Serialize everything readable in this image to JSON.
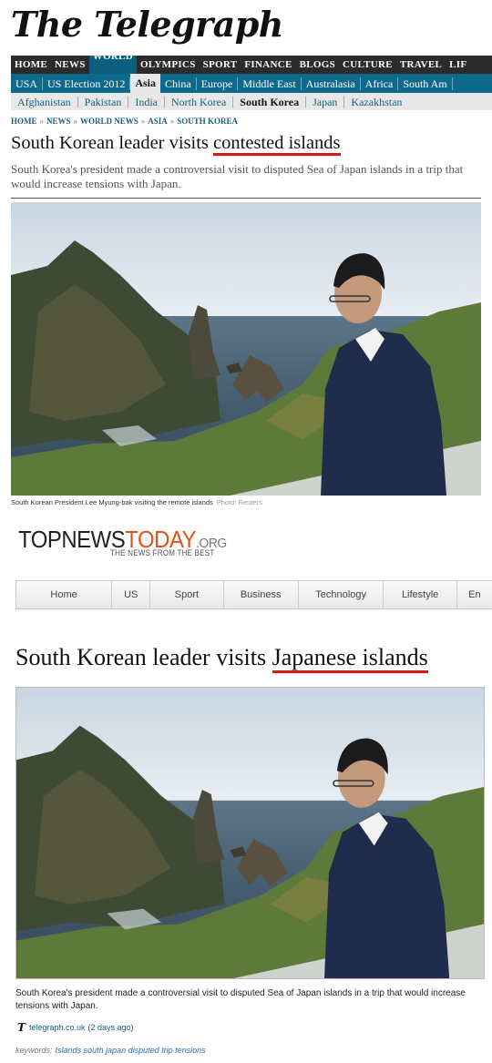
{
  "telegraph": {
    "logo": "The Telegraph",
    "nav_primary": [
      "HOME",
      "NEWS",
      "WORLD",
      "OLYMPICS",
      "SPORT",
      "FINANCE",
      "BLOGS",
      "CULTURE",
      "TRAVEL",
      "LIF"
    ],
    "nav_primary_active": "WORLD",
    "nav_secondary": [
      "USA",
      "US Election 2012",
      "Asia",
      "China",
      "Europe",
      "Middle East",
      "Australasia",
      "Africa",
      "South Am"
    ],
    "nav_secondary_active": "Asia",
    "nav_tertiary": [
      "Afghanistan",
      "Pakistan",
      "India",
      "North Korea",
      "South Korea",
      "Japan",
      "Kazakhstan"
    ],
    "nav_tertiary_active": "South Korea",
    "breadcrumb": [
      "HOME",
      "NEWS",
      "WORLD NEWS",
      "ASIA",
      "SOUTH KOREA"
    ],
    "breadcrumb_sep": "»",
    "headline_pre": "South Korean leader visits ",
    "headline_highlight": "contested islands",
    "standfirst": "South Korea's president made a controversial visit to disputed Sea of Japan islands in a trip that would increase tensions with Japan.",
    "caption": "South Korean President Lee Myung-bak visiting the remote islands",
    "photo_credit": "Photo: Reuters"
  },
  "topnewstoday": {
    "logo_part1": "TOPNEWS",
    "logo_part2": "TODAY",
    "logo_part3": ".ORG",
    "tagline": "THE NEWS FROM THE BEST",
    "nav": [
      "Home",
      "US",
      "Sport",
      "Business",
      "Technology",
      "Lifestyle",
      "En"
    ],
    "headline_pre": "South Korean leader visits ",
    "headline_highlight": "Japanese islands",
    "summary": "South Korea's president made a controversial visit to disputed Sea of Japan islands in a trip that would increase tensions with Japan.",
    "source_icon": "T",
    "source": "telegraph.co.uk",
    "source_age": "(2 days ago)",
    "keywords_label": "keywords:",
    "keywords": "Islands south japan disputed trip tensions"
  },
  "colors": {
    "highlight_underline": "#d01a1a",
    "telegraph_blue": "#0d6a8a",
    "tnt_orange": "#e2541a"
  }
}
